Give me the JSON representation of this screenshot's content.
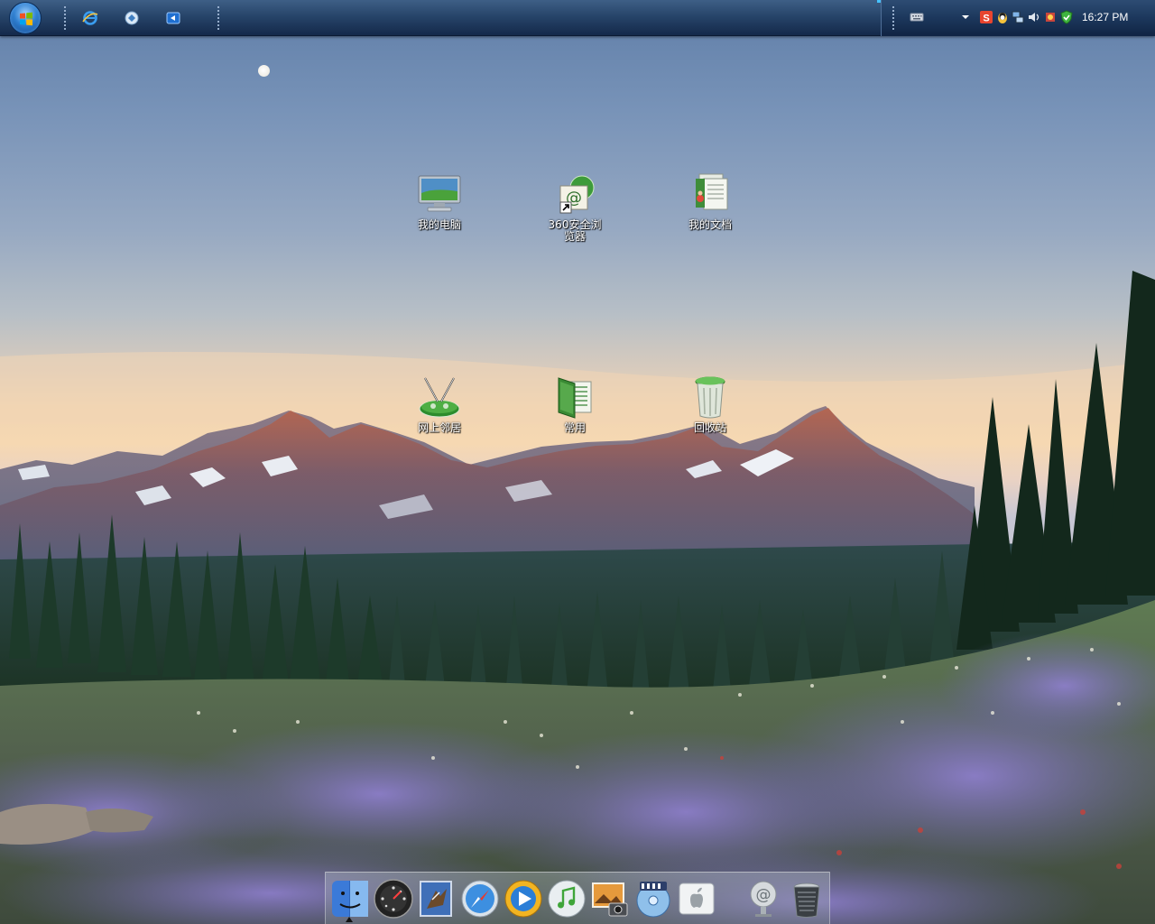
{
  "taskbar": {
    "start_icon": "windows-start-orb",
    "quick_launch": [
      {
        "name": "ie-icon"
      },
      {
        "name": "show-desktop-icon"
      },
      {
        "name": "switch-windows-icon"
      }
    ],
    "tray_icons": [
      "keyboard-icon",
      "tray-expand-arrow-icon",
      "sogou-input-icon",
      "qq-icon",
      "network-icon",
      "volume-icon",
      "security-icon",
      "360-guard-icon"
    ],
    "clock": "16:27 PM"
  },
  "desktop": {
    "icons": [
      {
        "id": "my-computer",
        "label": "我的电脑",
        "icon": "monitor-icon"
      },
      {
        "id": "360-browser",
        "label": "360安全浏览器",
        "icon": "browser-icon",
        "shortcut": true
      },
      {
        "id": "my-documents",
        "label": "我的文档",
        "icon": "documents-icon"
      },
      {
        "id": "network-places",
        "label": "网上邻居",
        "icon": "network-places-icon"
      },
      {
        "id": "common",
        "label": "常用",
        "icon": "folder-icon"
      },
      {
        "id": "recycle-bin",
        "label": "回收站",
        "icon": "recycle-bin-icon"
      }
    ]
  },
  "dock": {
    "items": [
      "finder-icon",
      "dashboard-icon",
      "mail-icon",
      "safari-icon",
      "quicktime-icon",
      "itunes-icon",
      "iphoto-icon",
      "dvd-player-icon",
      "apple-icon",
      "address-book-icon",
      "trash-icon"
    ]
  },
  "colors": {
    "taskbar_top": "#3e5f86",
    "taskbar_bottom": "#14294a",
    "tray_accent": "#46c2ff",
    "label_text": "#ffffff"
  }
}
